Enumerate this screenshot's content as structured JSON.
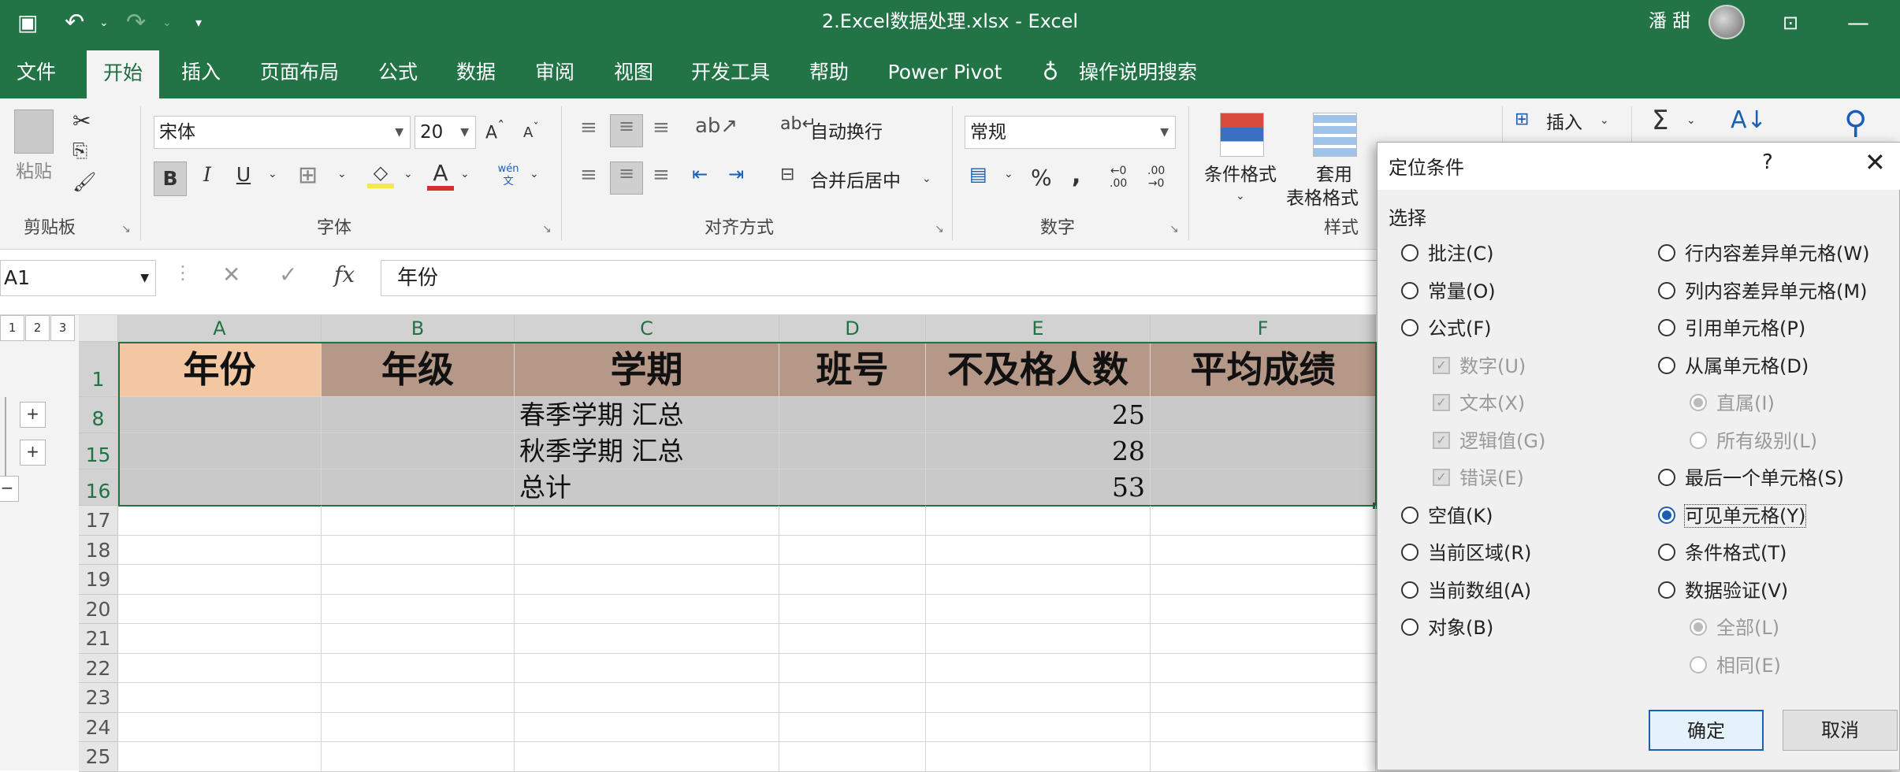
{
  "window": {
    "title": "2.Excel数据处理.xlsx - Excel",
    "user": "潘 甜"
  },
  "tabs": [
    "文件",
    "开始",
    "插入",
    "页面布局",
    "公式",
    "数据",
    "审阅",
    "视图",
    "开发工具",
    "帮助",
    "Power Pivot",
    "操作说明搜索"
  ],
  "active_tab": "开始",
  "ribbon": {
    "clipboard": {
      "paste": "粘贴",
      "label": "剪贴板"
    },
    "font": {
      "name": "宋体",
      "size": "20",
      "bold": "B",
      "italic": "I",
      "underline": "U",
      "phonetic": "wén\n文",
      "label": "字体"
    },
    "alignment": {
      "wrap": "自动换行",
      "merge": "合并后居中",
      "label": "对齐方式"
    },
    "number": {
      "format": "常规",
      "percent": "%",
      "comma": ",",
      "inc_dec": "←0\n.00",
      "dec_dec": ".00\n→0",
      "label": "数字"
    },
    "styles": {
      "conditional": "条件格式",
      "table1": "套用",
      "table2": "表格格式",
      "label": "样式"
    },
    "cells": {
      "insert": "插入"
    },
    "editing": {
      "sum": "Σ"
    }
  },
  "formula_bar": {
    "name_box": "A1",
    "fx": "fx",
    "content": "年份"
  },
  "outline": {
    "levels": [
      "1",
      "2",
      "3"
    ]
  },
  "sheet": {
    "columns": [
      "A",
      "B",
      "C",
      "D",
      "E",
      "F"
    ],
    "header_row_num": "1",
    "headers": [
      "年份",
      "年级",
      "学期",
      "班号",
      "不及格人数",
      "平均成绩"
    ],
    "data_rows": [
      {
        "num": "8",
        "cells": [
          "",
          "",
          "春季学期 汇总",
          "",
          "25",
          ""
        ]
      },
      {
        "num": "15",
        "cells": [
          "",
          "",
          "秋季学期 汇总",
          "",
          "28",
          ""
        ]
      },
      {
        "num": "16",
        "cells": [
          "",
          "",
          "总计",
          "",
          "53",
          ""
        ]
      }
    ],
    "empty_rows": [
      "17",
      "18",
      "19",
      "20",
      "21",
      "22",
      "23",
      "24",
      "25"
    ]
  },
  "dialog": {
    "title": "定位条件",
    "help": "?",
    "close": "✕",
    "section": "选择",
    "left_options": [
      {
        "label": "批注(C)",
        "kind": "radio",
        "state": "off"
      },
      {
        "label": "常量(O)",
        "kind": "radio",
        "state": "off"
      },
      {
        "label": "公式(F)",
        "kind": "radio",
        "state": "off"
      },
      {
        "label": "数字(U)",
        "kind": "check",
        "state": "disabled"
      },
      {
        "label": "文本(X)",
        "kind": "check",
        "state": "disabled"
      },
      {
        "label": "逻辑值(G)",
        "kind": "check",
        "state": "disabled"
      },
      {
        "label": "错误(E)",
        "kind": "check",
        "state": "disabled"
      },
      {
        "label": "空值(K)",
        "kind": "radio",
        "state": "off"
      },
      {
        "label": "当前区域(R)",
        "kind": "radio",
        "state": "off"
      },
      {
        "label": "当前数组(A)",
        "kind": "radio",
        "state": "off"
      },
      {
        "label": "对象(B)",
        "kind": "radio",
        "state": "off"
      }
    ],
    "right_options": [
      {
        "label": "行内容差异单元格(W)",
        "kind": "radio",
        "state": "off"
      },
      {
        "label": "列内容差异单元格(M)",
        "kind": "radio",
        "state": "off"
      },
      {
        "label": "引用单元格(P)",
        "kind": "radio",
        "state": "off"
      },
      {
        "label": "从属单元格(D)",
        "kind": "radio",
        "state": "off"
      },
      {
        "label": "直属(I)",
        "kind": "radio",
        "state": "disabled-on"
      },
      {
        "label": "所有级别(L)",
        "kind": "radio",
        "state": "disabled"
      },
      {
        "label": "最后一个单元格(S)",
        "kind": "radio",
        "state": "off"
      },
      {
        "label": "可见单元格(Y)",
        "kind": "radio",
        "state": "on"
      },
      {
        "label": "条件格式(T)",
        "kind": "radio",
        "state": "off"
      },
      {
        "label": "数据验证(V)",
        "kind": "radio",
        "state": "off"
      },
      {
        "label": "全部(L)",
        "kind": "radio",
        "state": "disabled-on"
      },
      {
        "label": "相同(E)",
        "kind": "radio",
        "state": "disabled"
      }
    ],
    "ok": "确定",
    "cancel": "取消"
  }
}
